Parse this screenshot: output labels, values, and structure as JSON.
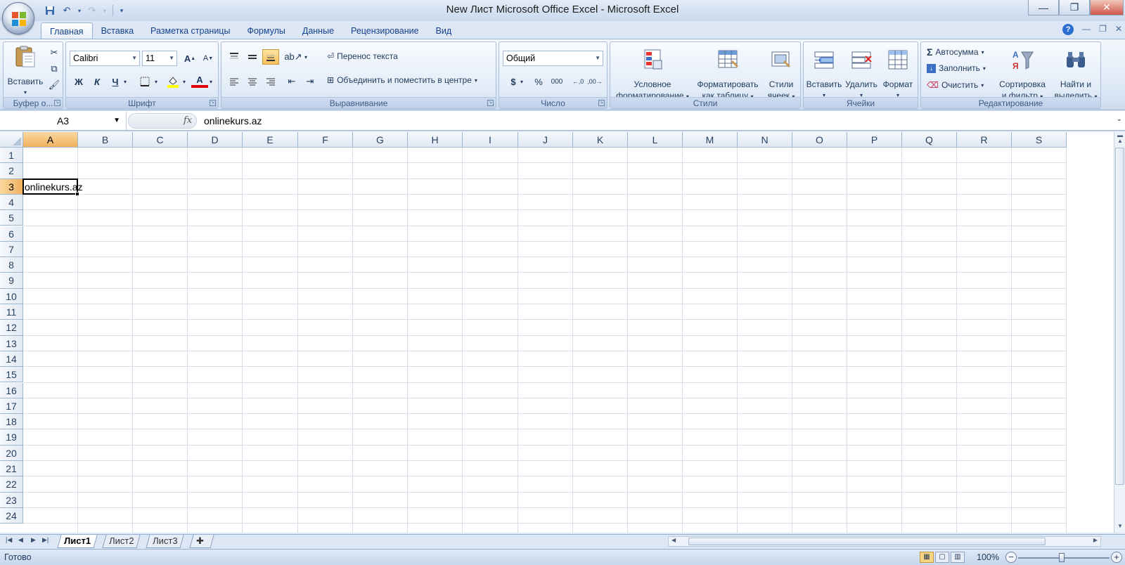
{
  "window": {
    "title": "New Лист Microsoft Office Excel - Microsoft Excel",
    "minimize": "—",
    "restore": "❐",
    "close": "✕"
  },
  "quick_access": {
    "save_icon": "save-icon",
    "undo_icon": "undo-icon",
    "redo_icon": "redo-icon"
  },
  "tabs": [
    "Главная",
    "Вставка",
    "Разметка страницы",
    "Формулы",
    "Данные",
    "Рецензирование",
    "Вид"
  ],
  "groups": {
    "clipboard": {
      "label": "Буфер о...",
      "paste": "Вставить"
    },
    "font": {
      "label": "Шрифт",
      "font_name": "Calibri",
      "font_size": "11",
      "bold": "Ж",
      "italic": "К",
      "underline": "Ч"
    },
    "alignment": {
      "label": "Выравнивание",
      "wrap_text": "Перенос текста",
      "merge_center": "Объединить и поместить в центре"
    },
    "number": {
      "label": "Число",
      "format": "Общий",
      "currency": "$",
      "percent": "%",
      "thousands": "000"
    },
    "styles": {
      "label": "Стили",
      "conditional": "Условное форматирование",
      "cond_line1": "Условное",
      "cond_line2": "форматирование",
      "format_table_line1": "Форматировать",
      "format_table_line2": "как таблицу",
      "cell_styles_line1": "Стили",
      "cell_styles_line2": "ячеек"
    },
    "cells": {
      "label": "Ячейки",
      "insert": "Вставить",
      "delete": "Удалить",
      "format": "Формат"
    },
    "editing": {
      "label": "Редактирование",
      "autosum": "Автосумма",
      "fill": "Заполнить",
      "clear": "Очистить",
      "sort_line1": "Сортировка",
      "sort_line2": "и фильтр",
      "find_line1": "Найти и",
      "find_line2": "выделить"
    }
  },
  "formula_bar": {
    "name_box": "A3",
    "fx": "fx",
    "content": "onlinekurs.az"
  },
  "grid": {
    "columns": [
      "A",
      "B",
      "C",
      "D",
      "E",
      "F",
      "G",
      "H",
      "I",
      "J",
      "K",
      "L",
      "M",
      "N",
      "O",
      "P",
      "Q",
      "R",
      "S"
    ],
    "rows": [
      "1",
      "2",
      "3",
      "4",
      "5",
      "6",
      "7",
      "8",
      "9",
      "10",
      "11",
      "12",
      "13",
      "14",
      "15",
      "16",
      "17",
      "18",
      "19",
      "20",
      "21",
      "22",
      "23",
      "24"
    ],
    "selected_column": "A",
    "selected_row": "3",
    "cells": {
      "A3": "onlinekurs.az"
    }
  },
  "sheets": [
    "Лист1",
    "Лист2",
    "Лист3"
  ],
  "active_sheet": "Лист1",
  "status": {
    "text": "Готово",
    "zoom": "100%"
  }
}
